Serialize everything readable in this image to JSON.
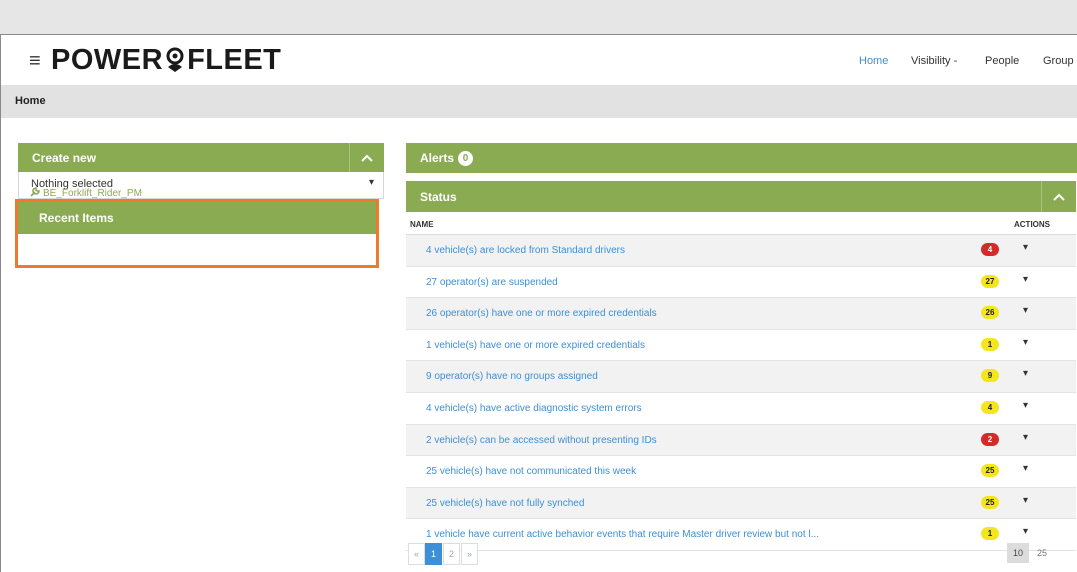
{
  "nav": {
    "menu_icon": "hamburger-icon",
    "logo_left": "POWER",
    "logo_right": "FLEET",
    "items": [
      "Home",
      "Visibility -",
      "People",
      "Group"
    ]
  },
  "breadcrumb": "Home",
  "create_new": {
    "title": "Create new",
    "select_value": "Nothing selected"
  },
  "recent": {
    "title": "Recent Items",
    "item": "BE_Forklift_Rider_PM"
  },
  "alerts": {
    "title": "Alerts",
    "count": "0"
  },
  "status": {
    "title": "Status",
    "col_name": "NAME",
    "col_actions": "ACTIONS",
    "rows": [
      {
        "label": "4 vehicle(s) are locked from Standard drivers",
        "count": "4",
        "color": "red"
      },
      {
        "label": "27 operator(s) are suspended",
        "count": "27",
        "color": "yellow"
      },
      {
        "label": "26 operator(s) have one or more expired credentials",
        "count": "26",
        "color": "yellow"
      },
      {
        "label": "1 vehicle(s) have one or more expired credentials",
        "count": "1",
        "color": "yellow"
      },
      {
        "label": "9 operator(s) have no groups assigned",
        "count": "9",
        "color": "yellow"
      },
      {
        "label": "4 vehicle(s) have active diagnostic system errors",
        "count": "4",
        "color": "yellow"
      },
      {
        "label": "2 vehicle(s) can be accessed without presenting IDs",
        "count": "2",
        "color": "red"
      },
      {
        "label": "25 vehicle(s) have not communicated this week",
        "count": "25",
        "color": "yellow"
      },
      {
        "label": "25 vehicle(s) have not fully synched",
        "count": "25",
        "color": "yellow"
      },
      {
        "label": "1 vehicle have current active behavior events that require Master driver review but not l...",
        "count": "1",
        "color": "yellow"
      }
    ]
  },
  "pagination": {
    "prev": "«",
    "pages": [
      "1",
      "2"
    ],
    "next": "»",
    "sizes": [
      "10",
      "25"
    ]
  },
  "colors": {
    "accent_green": "#8aab52",
    "highlight_orange": "#ee7a2e",
    "link_blue": "#3d8fd6"
  }
}
